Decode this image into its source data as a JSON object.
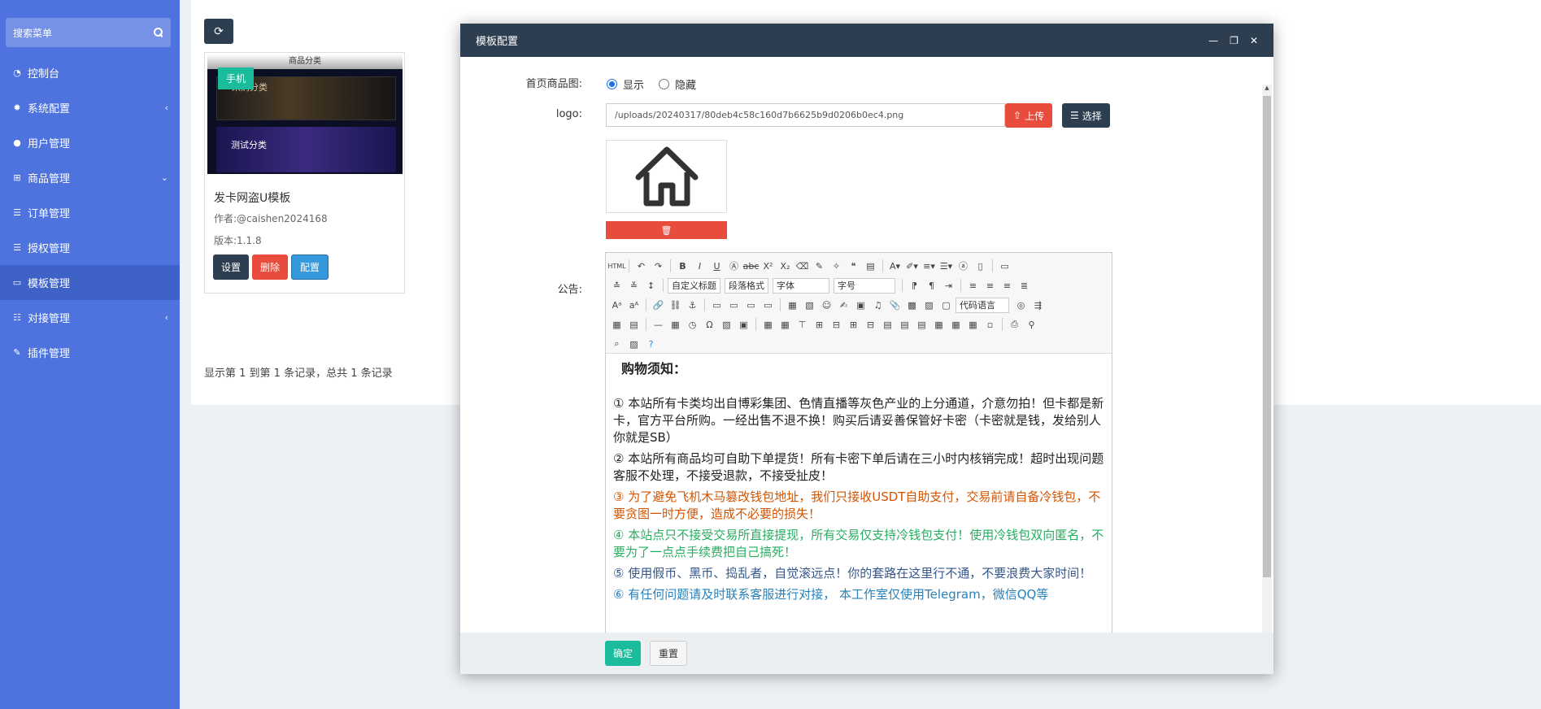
{
  "sidebar": {
    "search_label": "搜索菜单",
    "items": [
      {
        "label": "控制台",
        "icon": "dashboard-icon",
        "arrow": ""
      },
      {
        "label": "系统配置",
        "icon": "gear-icon",
        "arrow": "‹"
      },
      {
        "label": "用户管理",
        "icon": "user-icon",
        "arrow": ""
      },
      {
        "label": "商品管理",
        "icon": "cart-icon",
        "arrow": "⌄"
      },
      {
        "label": "订单管理",
        "icon": "list-icon",
        "arrow": ""
      },
      {
        "label": "授权管理",
        "icon": "list-icon",
        "arrow": ""
      },
      {
        "label": "模板管理",
        "icon": "template-icon",
        "arrow": ""
      },
      {
        "label": "对接管理",
        "icon": "sliders-icon",
        "arrow": "‹"
      },
      {
        "label": "插件管理",
        "icon": "plugin-icon",
        "arrow": ""
      }
    ]
  },
  "card": {
    "tag": "手机",
    "img_strip": "商品分类",
    "img_text1": "采购分类",
    "img_text2": "测试分类",
    "title": "发卡网盗U模板",
    "author": "作者:@caishen2024168",
    "version": "版本:1.1.8",
    "btn_settings": "设置",
    "btn_delete": "删除",
    "btn_config": "配置"
  },
  "pager": {
    "text": "显示第 1 到第 1 条记录，总共 1 条记录"
  },
  "modal": {
    "title": "模板配置",
    "home_label": "首页商品图:",
    "opt_show": "显示",
    "opt_hide": "隐藏",
    "logo_label": "logo:",
    "logo_value": "/uploads/20240317/80deb4c58c160d7b6625b9d0206b0ec4.png",
    "upload_label": "上传",
    "choose_label": "选择",
    "notice_label": "公告:",
    "toolbar": {
      "custom_title": "自定义标题",
      "paragraph": "段落格式",
      "font": "字体",
      "font_size": "字号",
      "code_lang": "代码语言"
    },
    "ok_label": "确定",
    "reset_label": "重置"
  },
  "announcement": {
    "title": "购物须知：",
    "p1": "① 本站所有卡类均出自博彩集团、色情直播等灰色产业的上分通道，介意勿拍！但卡都是新卡，官方平台所购。一经出售不退不换！购买后请妥善保管好卡密（卡密就是钱，发给别人你就是SB）",
    "p2": "② 本站所有商品均可自助下单提货！所有卡密下单后请在三小时内核销完成！超时出现问题客服不处理，不接受退款，不接受扯皮！",
    "p3": "③ 为了避免飞机木马篡改钱包地址，我们只接收USDT自助支付，交易前请自备冷钱包，不要贪图一时方便，造成不必要的损失！",
    "p4": "④ 本站点只不接受交易所直接提现，所有交易仅支持冷钱包支付！使用冷钱包双向匿名，不要为了一点点手续费把自己搞死！",
    "p5": "⑤ 使用假币、黑币、捣乱者，自觉滚远点！你的套路在这里行不通，不要浪费大家时间！",
    "p6": "⑥ 有任何问题请及时联系客服进行对接， 本工作室仅使用Telegram，微信QQ等"
  },
  "colors": {
    "sidebar_bg": "#4e73df",
    "header_dark": "#2c3e50",
    "danger": "#e74c3c",
    "success": "#1abc9c",
    "primary": "#3498db"
  }
}
